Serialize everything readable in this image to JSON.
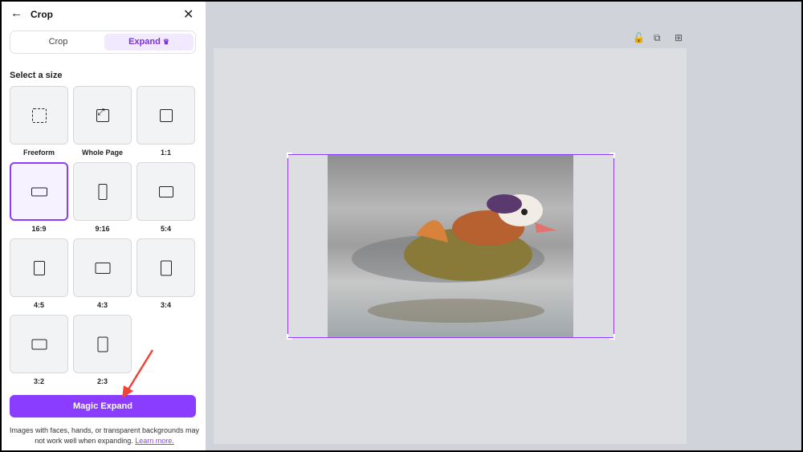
{
  "panel": {
    "title": "Crop",
    "tabs": [
      {
        "label": "Crop"
      },
      {
        "label": "Expand"
      }
    ],
    "section_label": "Select a size",
    "sizes": [
      {
        "label": "Freeform"
      },
      {
        "label": "Whole Page"
      },
      {
        "label": "1:1"
      },
      {
        "label": "16:9"
      },
      {
        "label": "9:16"
      },
      {
        "label": "5:4"
      },
      {
        "label": "4:5"
      },
      {
        "label": "4:3"
      },
      {
        "label": "3:4"
      },
      {
        "label": "3:2"
      },
      {
        "label": "2:3"
      }
    ],
    "selected_size": "16:9",
    "magic_expand": "Magic Expand",
    "note": "Images with faces, hands, or transparent backgrounds may not work well when expanding.",
    "learn_more": "Learn more."
  },
  "colors": {
    "accent": "#8b3dff",
    "arrow": "#f04438"
  }
}
